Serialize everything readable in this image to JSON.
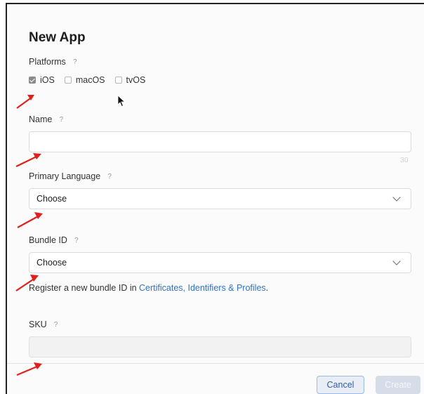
{
  "dialog": {
    "title": "New App",
    "platforms": {
      "label": "Platforms",
      "help": "?",
      "options": [
        {
          "label": "iOS",
          "checked": true
        },
        {
          "label": "macOS",
          "checked": false
        },
        {
          "label": "tvOS",
          "checked": false
        }
      ]
    },
    "name": {
      "label": "Name",
      "help": "?",
      "value": "",
      "counter": "30"
    },
    "primary_language": {
      "label": "Primary Language",
      "help": "?",
      "selected": "Choose"
    },
    "bundle_id": {
      "label": "Bundle ID",
      "help": "?",
      "selected": "Choose",
      "register_text": "Register a new bundle ID in ",
      "register_link": "Certificates, Identifiers & Profiles",
      "register_suffix": "."
    },
    "sku": {
      "label": "SKU",
      "help": "?",
      "value": ""
    },
    "buttons": {
      "cancel": "Cancel",
      "create": "Create"
    }
  },
  "colors": {
    "link": "#2f72c2",
    "annotation_arrow": "#e0201b",
    "create_disabled": "#d6dde8"
  },
  "icons": [
    "checkbox-checked",
    "checkbox-empty",
    "chevron-down-icon",
    "mouse-cursor-icon",
    "red-arrow-annotation"
  ]
}
